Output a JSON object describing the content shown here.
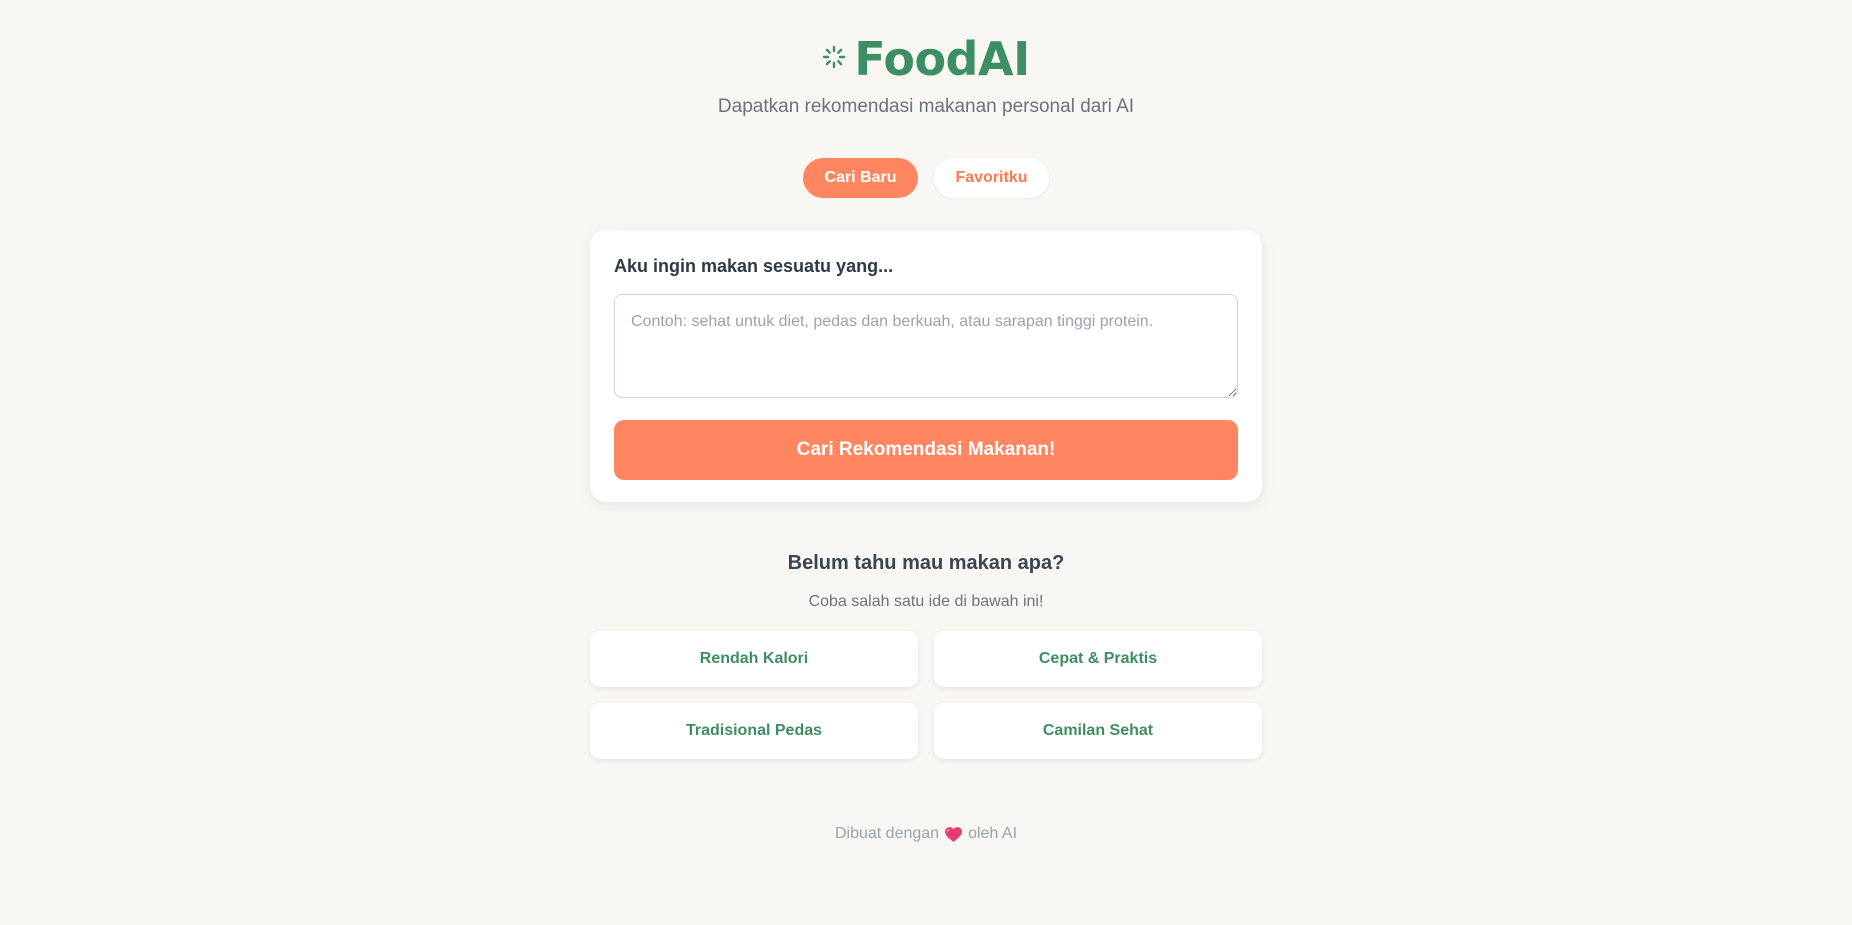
{
  "header": {
    "logo_icon": "sparkle-icon",
    "title": "FoodAI",
    "subtitle": "Dapatkan rekomendasi makanan personal dari AI"
  },
  "tabs": [
    {
      "label": "Cari Baru",
      "active": true
    },
    {
      "label": "Favoritku",
      "active": false
    }
  ],
  "search_card": {
    "label": "Aku ingin makan sesuatu yang...",
    "input_value": "",
    "input_placeholder": "Contoh: sehat untuk diet, pedas dan berkuah, atau sarapan tinggi protein.",
    "submit_label": "Cari Rekomendasi Makanan!"
  },
  "ideas": {
    "title": "Belum tahu mau makan apa?",
    "subtitle": "Coba salah satu ide di bawah ini!",
    "items": [
      {
        "label": "Rendah Kalori"
      },
      {
        "label": "Cepat & Praktis"
      },
      {
        "label": "Tradisional Pedas"
      },
      {
        "label": "Camilan Sehat"
      }
    ]
  },
  "footer": {
    "prefix": "Dibuat dengan",
    "icon": "heart-icon",
    "suffix": "oleh AI"
  },
  "colors": {
    "background": "#f8f7f4",
    "brand_green": "#3e8e63",
    "accent_orange": "#ff8660",
    "heart": "#e63b6f"
  }
}
